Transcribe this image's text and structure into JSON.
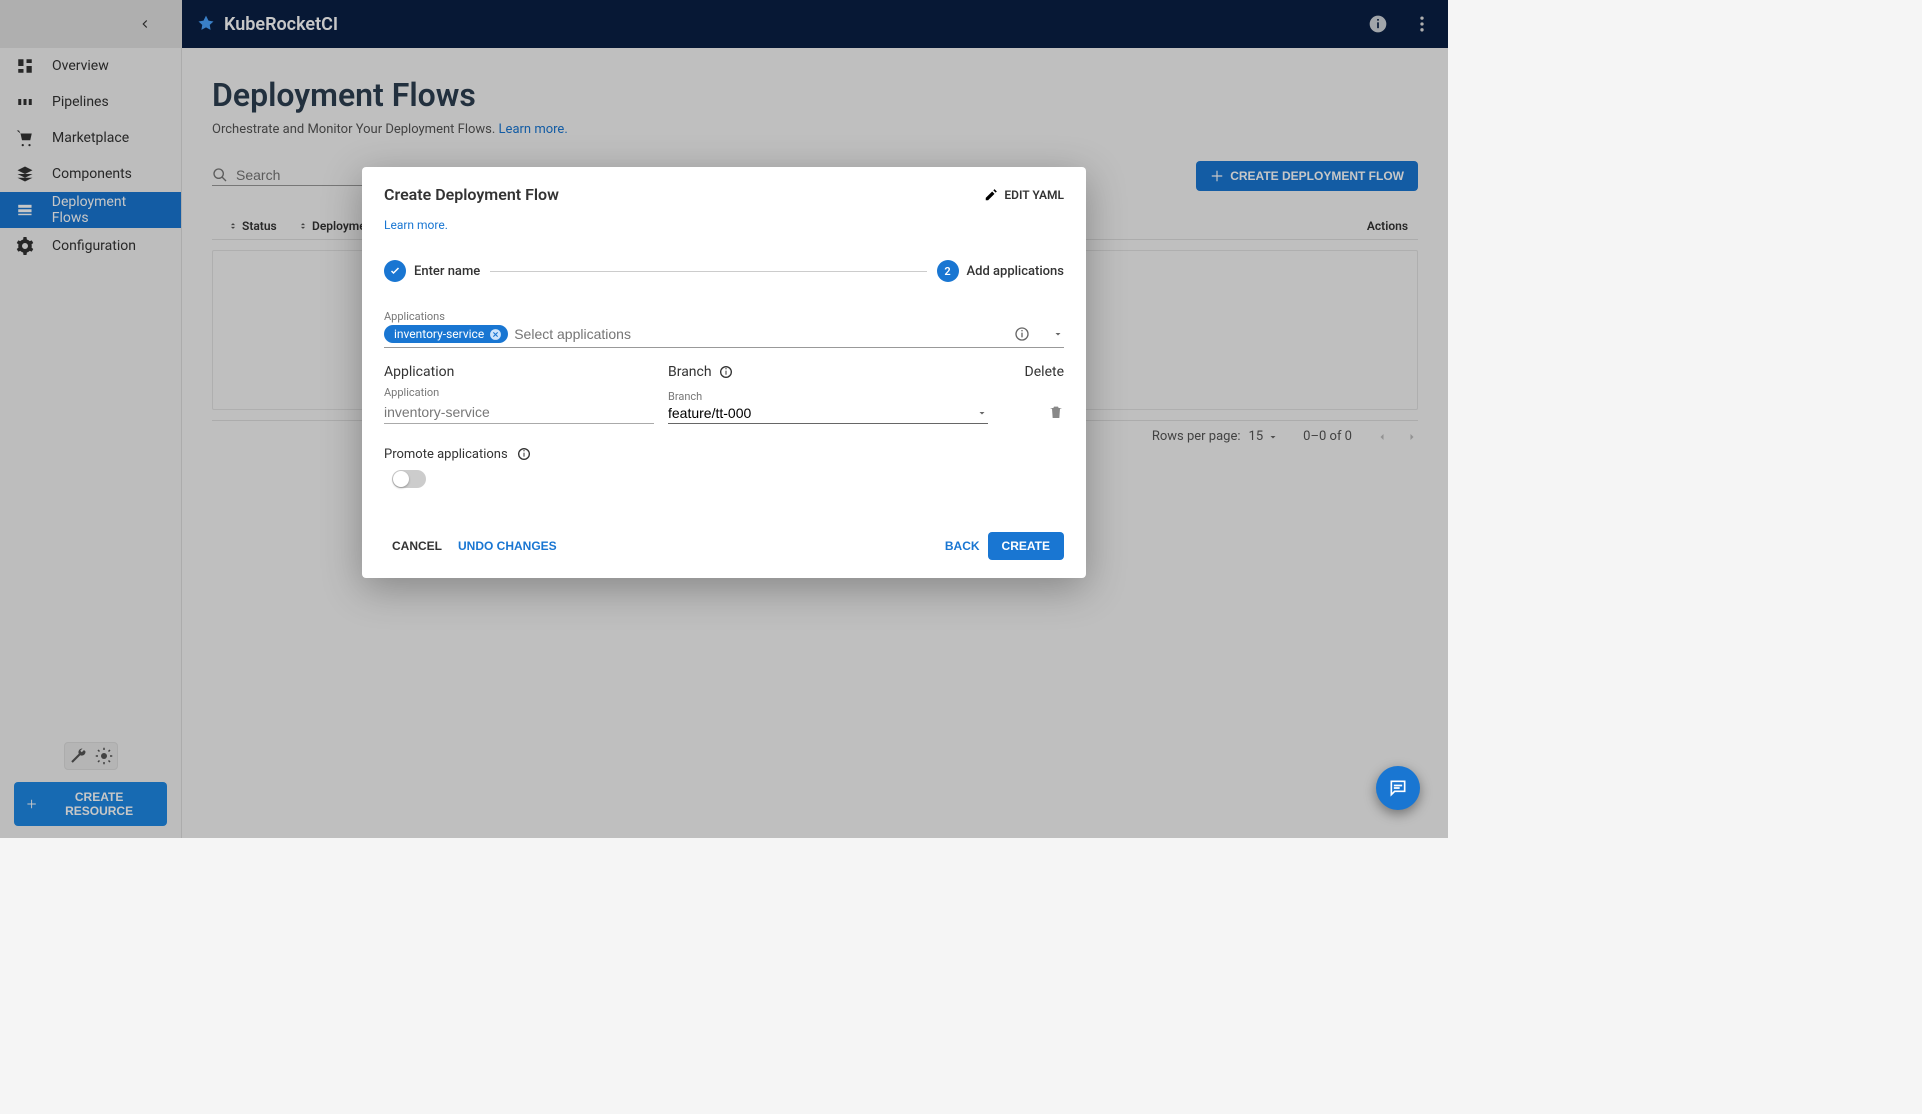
{
  "brand": "KubeRocketCI",
  "sidebar": {
    "items": [
      {
        "label": "Overview"
      },
      {
        "label": "Pipelines"
      },
      {
        "label": "Marketplace"
      },
      {
        "label": "Components"
      },
      {
        "label": "Deployment Flows"
      },
      {
        "label": "Configuration"
      }
    ],
    "create_resource": "CREATE RESOURCE"
  },
  "page": {
    "title": "Deployment Flows",
    "subtitle": "Orchestrate and Monitor Your Deployment Flows.",
    "learn_more": "Learn more."
  },
  "toolbar": {
    "search_placeholder": "Search",
    "create_flow": "CREATE DEPLOYMENT FLOW"
  },
  "table": {
    "status_hdr": "Status",
    "df_hdr": "Deployment F",
    "actions_hdr": "Actions",
    "rows_per_page_label": "Rows per page:",
    "rows_per_page_value": "15",
    "range": "0–0 of 0"
  },
  "dialog": {
    "title": "Create Deployment Flow",
    "edit_yaml": "EDIT YAML",
    "learn_more": "Learn more.",
    "step1": "Enter name",
    "step2_num": "2",
    "step2": "Add applications",
    "applications_label": "Applications",
    "chip": "inventory-service",
    "apps_placeholder": "Select applications",
    "col_app": "Application",
    "col_branch": "Branch",
    "col_delete": "Delete",
    "row_app_label": "Application",
    "row_app_value": "inventory-service",
    "row_branch_label": "Branch",
    "row_branch_value": "feature/tt-000",
    "promote_label": "Promote applications",
    "cancel": "CANCEL",
    "undo": "UNDO CHANGES",
    "back": "BACK",
    "create": "CREATE"
  }
}
